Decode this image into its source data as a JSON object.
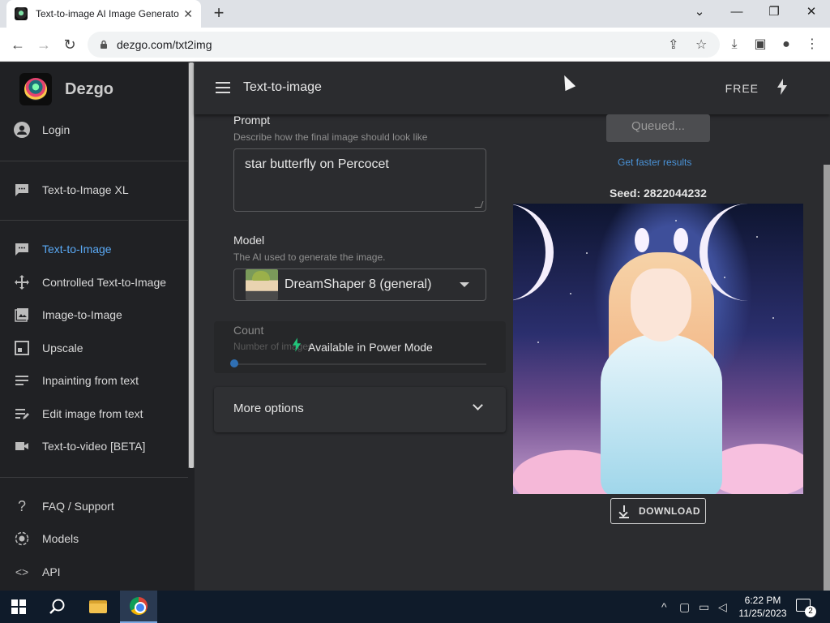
{
  "browser": {
    "tab_title": "Text-to-image AI Image Generato",
    "url": "dezgo.com/txt2img"
  },
  "sidebar": {
    "brand": "Dezgo",
    "login": "Login",
    "items": [
      {
        "label": "Text-to-Image XL",
        "icon": "chat-icon"
      },
      {
        "label": "Text-to-Image",
        "icon": "chat-icon",
        "active": true
      },
      {
        "label": "Controlled Text-to-Image",
        "icon": "move-icon"
      },
      {
        "label": "Image-to-Image",
        "icon": "image-icon"
      },
      {
        "label": "Upscale",
        "icon": "expand-icon"
      },
      {
        "label": "Inpainting from text",
        "icon": "list-icon"
      },
      {
        "label": "Edit image from text",
        "icon": "edit-icon"
      },
      {
        "label": "Text-to-video [BETA]",
        "icon": "video-icon"
      },
      {
        "label": "FAQ / Support",
        "icon": "help-icon"
      },
      {
        "label": "Models",
        "icon": "models-icon"
      },
      {
        "label": "API",
        "icon": "code-icon"
      }
    ]
  },
  "topbar": {
    "title": "Text-to-image",
    "plan": "FREE"
  },
  "form": {
    "prompt_label": "Prompt",
    "prompt_hint": "Describe how the final image should look like",
    "prompt_value": "star butterfly on Percocet",
    "model_label": "Model",
    "model_hint": "The AI used to generate the image.",
    "model_value": "DreamShaper 8 (general)",
    "count_label": "Count",
    "count_hint": "Number of images",
    "power_mode": "Available in Power Mode",
    "more_options": "More options"
  },
  "result": {
    "queued": "Queued...",
    "faster": "Get faster results",
    "seed": "Seed: 2822044232",
    "download": "DOWNLOAD"
  },
  "taskbar": {
    "time": "6:22 PM",
    "date": "11/25/2023",
    "notifications": "2"
  },
  "colors": {
    "accent": "#5aa9f5",
    "power": "#22c47a",
    "background": "#2b2c2f",
    "sidebar": "#202124"
  }
}
